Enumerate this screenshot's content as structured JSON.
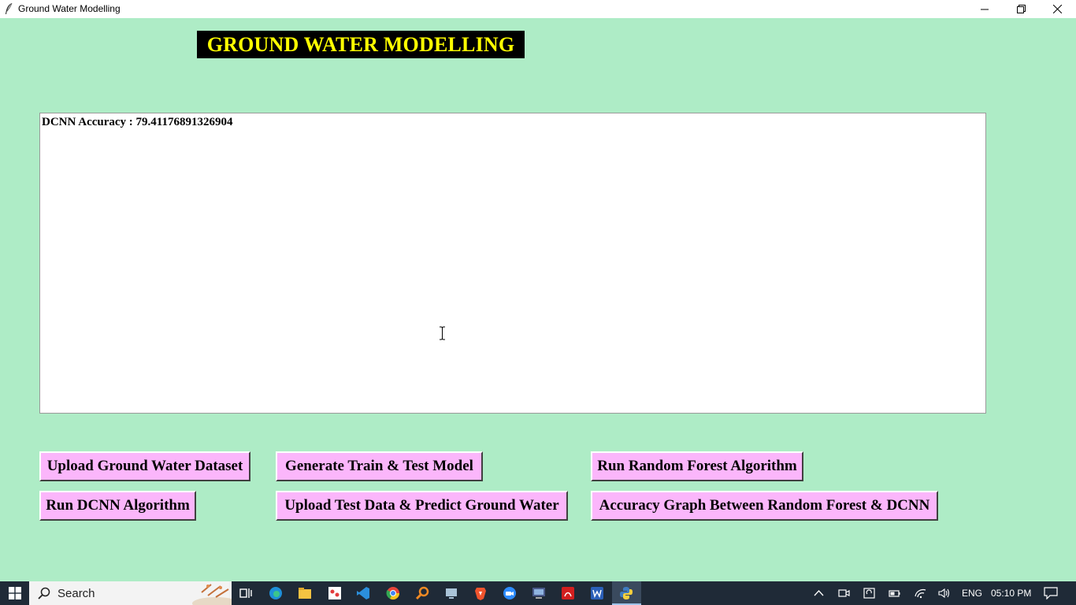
{
  "window": {
    "title": "Ground Water Modelling"
  },
  "heading": "GROUND WATER MODELLING",
  "output": {
    "text": "DCNN Accuracy : 79.41176891326904"
  },
  "buttons": {
    "upload_dataset": "Upload Ground Water Dataset",
    "generate_model": "Generate Train & Test Model",
    "run_rf": "Run Random Forest Algorithm",
    "run_dcnn": "Run DCNN Algorithm",
    "upload_test": "Upload Test Data & Predict Ground Water",
    "accuracy_graph": "Accuracy Graph Between Random Forest & DCNN"
  },
  "taskbar": {
    "search_placeholder": "Search",
    "language": "ENG",
    "time": "05:10 PM"
  },
  "colors": {
    "background": "#aeecc6",
    "heading_bg": "#000000",
    "heading_fg": "#ffff00",
    "button_bg": "#fbb6fb",
    "taskbar_bg": "#1f2a37"
  }
}
